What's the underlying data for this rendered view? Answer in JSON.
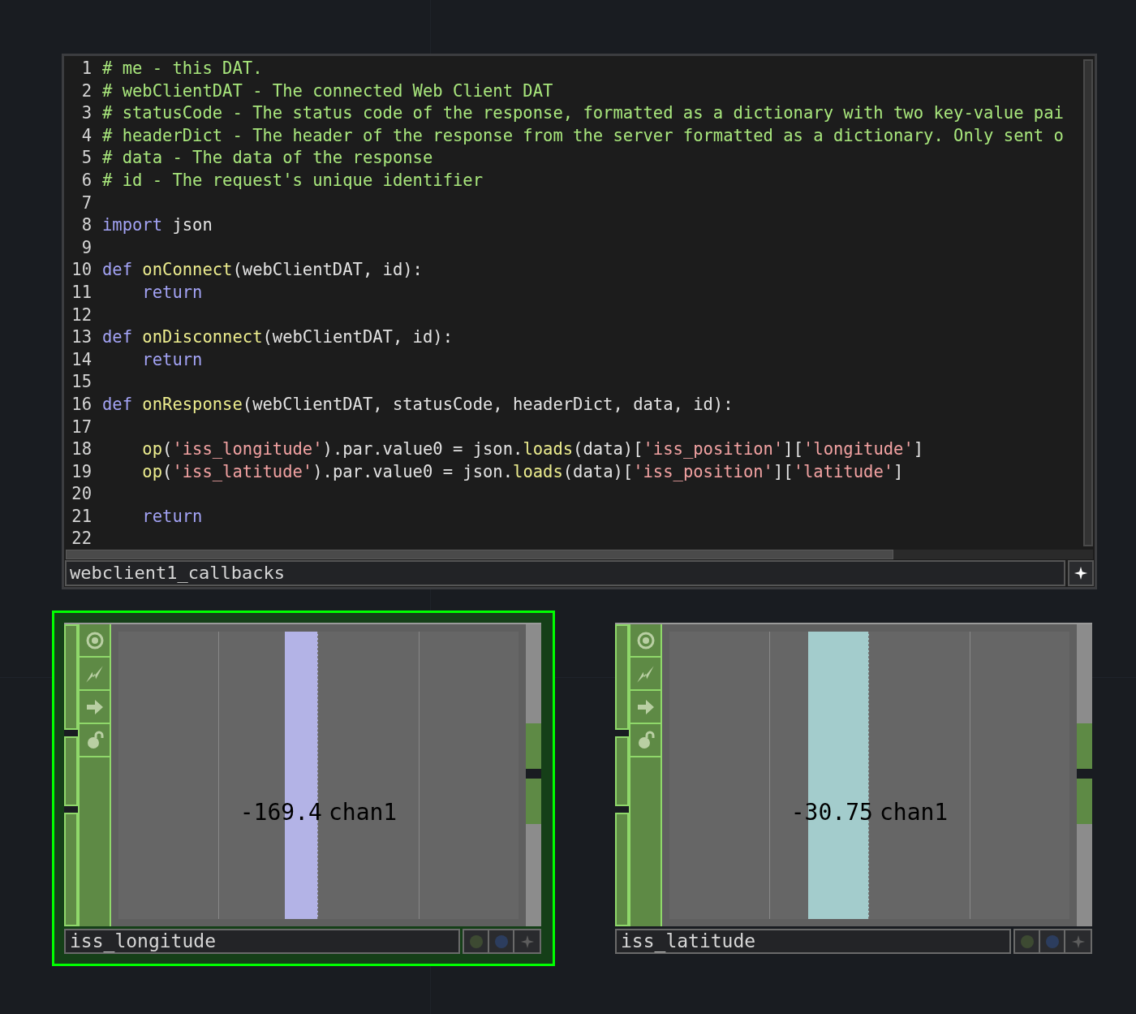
{
  "dat": {
    "lines": [
      {
        "number": "1",
        "tokens": [
          {
            "kind": "comment",
            "text": "# me - this DAT."
          }
        ]
      },
      {
        "number": "2",
        "tokens": [
          {
            "kind": "comment",
            "text": "# webClientDAT - The connected Web Client DAT"
          }
        ]
      },
      {
        "number": "3",
        "tokens": [
          {
            "kind": "comment",
            "text": "# statusCode - The status code of the response, formatted as a dictionary with two key-value pai"
          }
        ]
      },
      {
        "number": "4",
        "tokens": [
          {
            "kind": "comment",
            "text": "# headerDict - The header of the response from the server formatted as a dictionary. Only sent o"
          }
        ]
      },
      {
        "number": "5",
        "tokens": [
          {
            "kind": "comment",
            "text": "# data - The data of the response"
          }
        ]
      },
      {
        "number": "6",
        "tokens": [
          {
            "kind": "comment",
            "text": "# id - The request's unique identifier"
          }
        ]
      },
      {
        "number": "7"
      },
      {
        "number": "8",
        "tokens": [
          {
            "kind": "keyword",
            "text": "import"
          },
          {
            "kind": "plain",
            "text": " json"
          }
        ]
      },
      {
        "number": "9"
      },
      {
        "number": "10",
        "tokens": [
          {
            "kind": "keyword",
            "text": "def"
          },
          {
            "kind": "function",
            "text": " onConnect"
          },
          {
            "kind": "plain",
            "text": "(webClientDAT, id):"
          }
        ]
      },
      {
        "number": "11",
        "tokens": [
          {
            "kind": "keyword",
            "text": "    return"
          }
        ]
      },
      {
        "number": "12"
      },
      {
        "number": "13",
        "tokens": [
          {
            "kind": "keyword",
            "text": "def"
          },
          {
            "kind": "function",
            "text": " onDisconnect"
          },
          {
            "kind": "plain",
            "text": "(webClientDAT, id):"
          }
        ]
      },
      {
        "number": "14",
        "tokens": [
          {
            "kind": "keyword",
            "text": "    return"
          }
        ]
      },
      {
        "number": "15"
      },
      {
        "number": "16",
        "tokens": [
          {
            "kind": "keyword",
            "text": "def"
          },
          {
            "kind": "function",
            "text": " onResponse"
          },
          {
            "kind": "plain",
            "text": "(webClientDAT, statusCode, headerDict, data, id):"
          }
        ]
      },
      {
        "number": "17"
      },
      {
        "number": "18",
        "tokens": [
          {
            "kind": "function",
            "text": "    op"
          },
          {
            "kind": "plain",
            "text": "("
          },
          {
            "kind": "string",
            "text": "'iss_longitude'"
          },
          {
            "kind": "plain",
            "text": ").par.value0 = json."
          },
          {
            "kind": "function",
            "text": "loads"
          },
          {
            "kind": "plain",
            "text": "(data)["
          },
          {
            "kind": "string",
            "text": "'iss_position'"
          },
          {
            "kind": "plain",
            "text": "]["
          },
          {
            "kind": "string",
            "text": "'longitude'"
          },
          {
            "kind": "plain",
            "text": "]"
          }
        ]
      },
      {
        "number": "19",
        "tokens": [
          {
            "kind": "function",
            "text": "    op"
          },
          {
            "kind": "plain",
            "text": "("
          },
          {
            "kind": "string",
            "text": "'iss_latitude'"
          },
          {
            "kind": "plain",
            "text": ").par.value0 = json."
          },
          {
            "kind": "function",
            "text": "loads"
          },
          {
            "kind": "plain",
            "text": "(data)["
          },
          {
            "kind": "string",
            "text": "'iss_position'"
          },
          {
            "kind": "plain",
            "text": "]["
          },
          {
            "kind": "string",
            "text": "'latitude'"
          },
          {
            "kind": "plain",
            "text": "]"
          }
        ]
      },
      {
        "number": "20"
      },
      {
        "number": "21",
        "tokens": [
          {
            "kind": "keyword",
            "text": "    return"
          }
        ]
      },
      {
        "number": "22"
      }
    ],
    "name": "webclient1_callbacks"
  },
  "nodes": [
    {
      "name": "iss_longitude",
      "selected": true,
      "value": "-169.4",
      "channel": "chan1",
      "color": "#b3b3e6"
    },
    {
      "name": "iss_latitude",
      "selected": false,
      "value": "-30.75",
      "channel": "chan1",
      "color": "#a3cccc"
    }
  ]
}
